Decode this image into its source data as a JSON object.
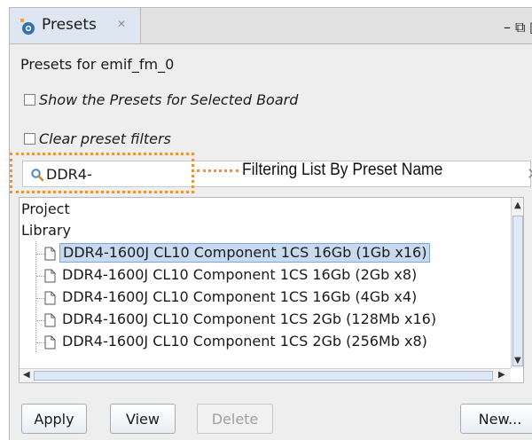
{
  "tab": {
    "title": "Presets",
    "close_glyph": "✕",
    "icon": "presets-icon"
  },
  "window_controls": {
    "minimize": "–",
    "restore": "⧉",
    "maximize": "□"
  },
  "heading": "Presets for emif_fm_0",
  "options": {
    "show_board": "Show the Presets for Selected Board",
    "clear_filters": "Clear preset filters"
  },
  "search": {
    "value": "DDR4-",
    "icon": "search-icon"
  },
  "annotation": {
    "text": "Filtering List By Preset Name",
    "color": "#f0922f"
  },
  "tree": {
    "project_label": "Project",
    "library_label": "Library",
    "items": [
      "DDR4-1600J CL10 Component 1CS 16Gb (1Gb x16)",
      "DDR4-1600J CL10 Component 1CS 16Gb (2Gb x8)",
      "DDR4-1600J CL10 Component 1CS 16Gb (4Gb x4)",
      "DDR4-1600J CL10 Component 1CS 2Gb (128Mb x16)",
      "DDR4-1600J CL10 Component 1CS 2Gb (256Mb x8)"
    ],
    "selected_index": 0,
    "selection_color": "#c8daf0"
  },
  "buttons": {
    "apply": "Apply",
    "view": "View",
    "delete": "Delete",
    "new": "New..."
  }
}
